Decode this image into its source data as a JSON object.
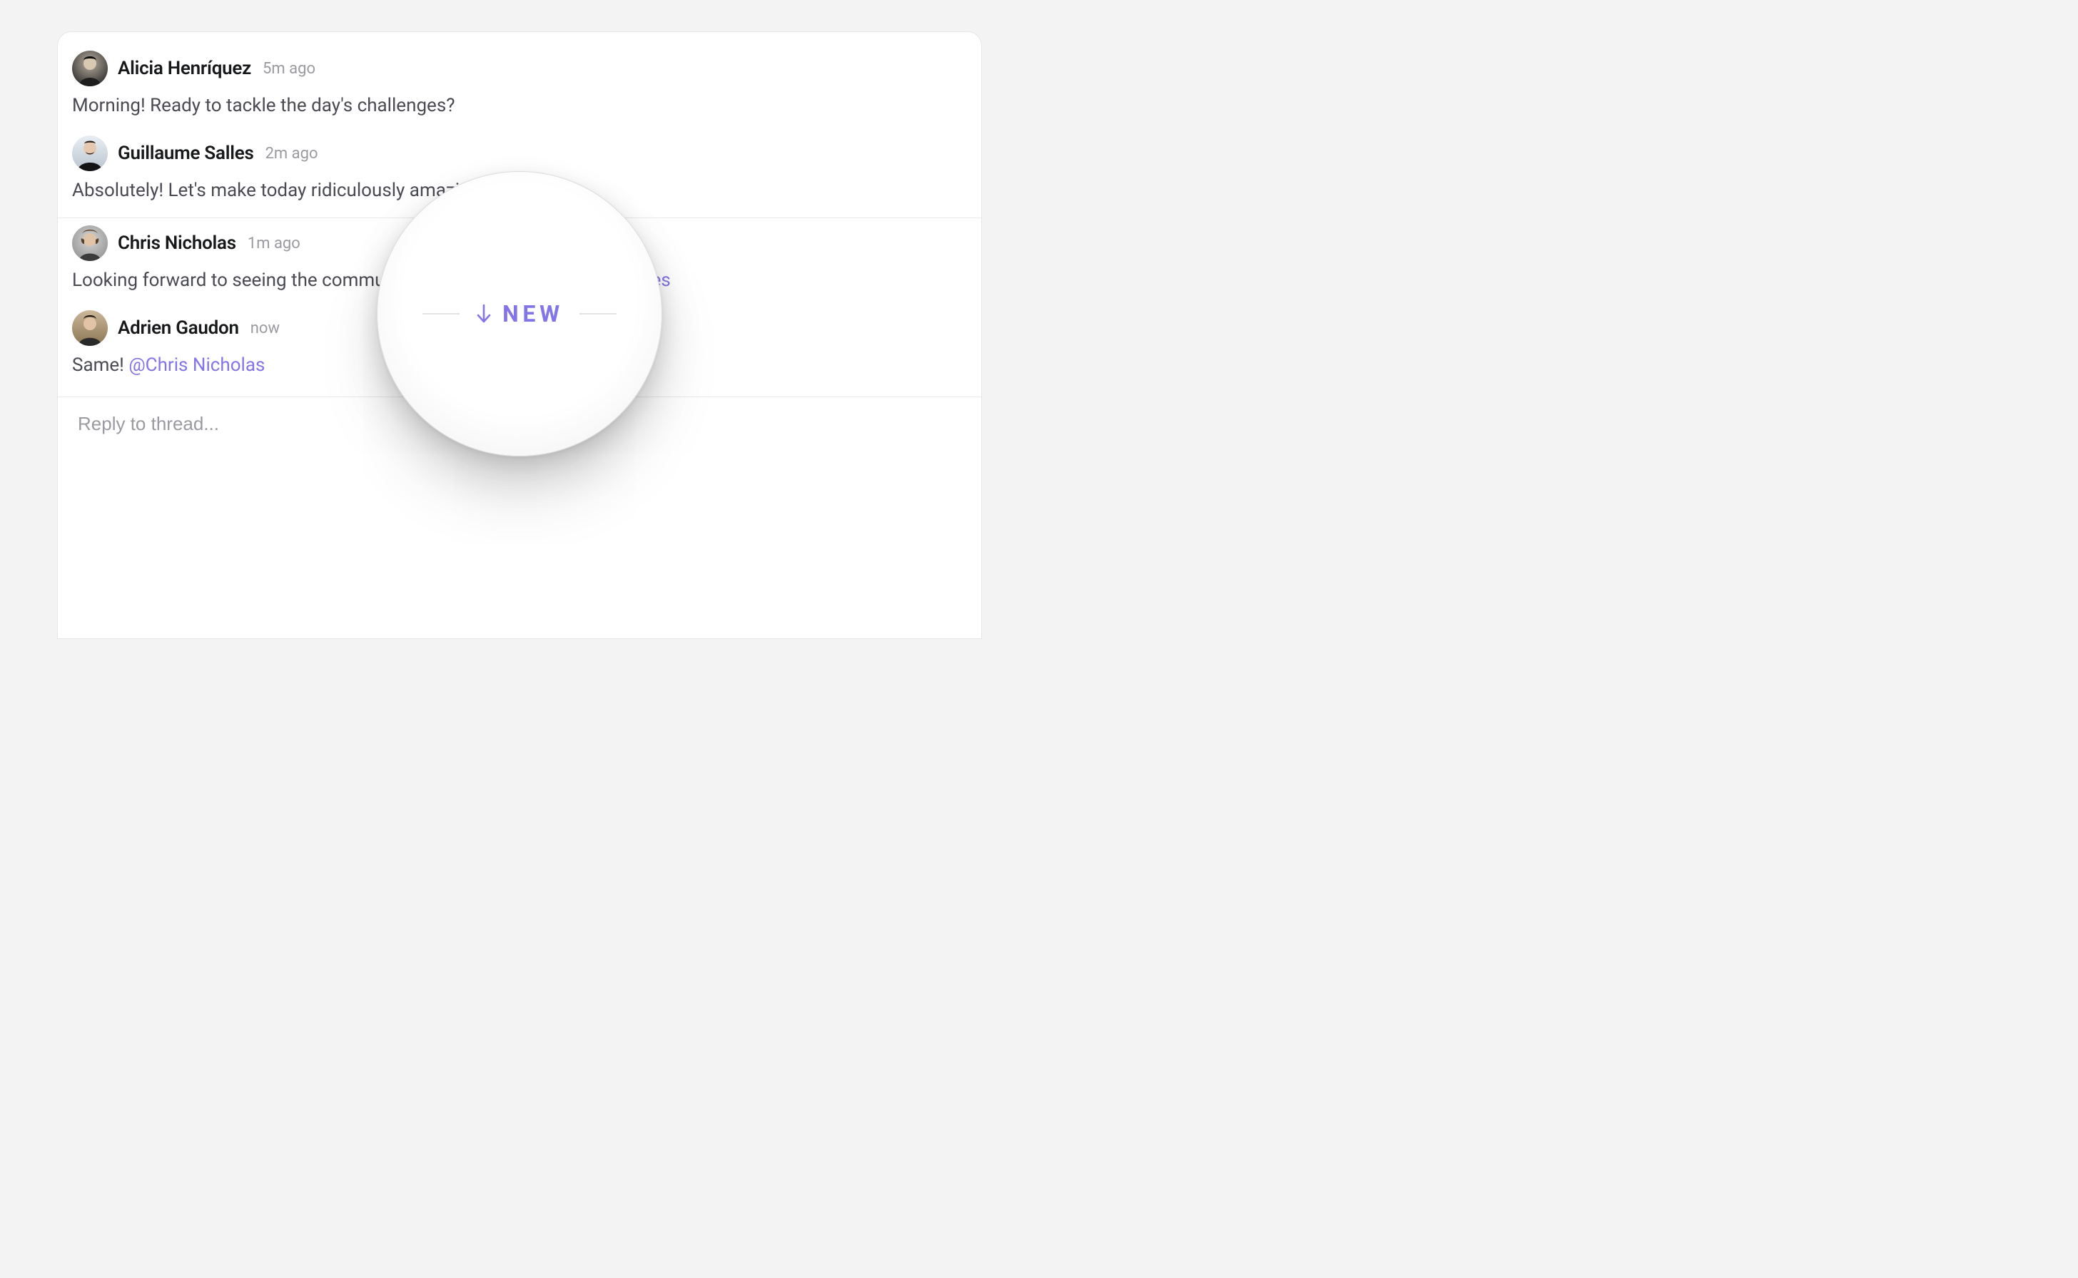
{
  "accent": "#8375e8",
  "thread": {
    "messages": [
      {
        "author": "Alicia Henríquez",
        "time": "5m ago",
        "body": "Morning! Ready to tackle the day's challenges?",
        "mention": null
      },
      {
        "author": "Guillaume Salles",
        "time": "2m ago",
        "body": "Absolutely! Let's make today ridiculously amazing!",
        "mention": null
      },
      {
        "author": "Chris Nicholas",
        "time": "1m ago",
        "body": "Looking forward to seeing the community's response! ",
        "mention": "@Guillaume Salles"
      },
      {
        "author": "Adrien Gaudon",
        "time": "now",
        "body": "Same! ",
        "mention": "@Chris Nicholas"
      }
    ]
  },
  "divider_after_index": 1,
  "new_badge": {
    "label": "NEW"
  },
  "composer": {
    "placeholder": "Reply to thread..."
  }
}
